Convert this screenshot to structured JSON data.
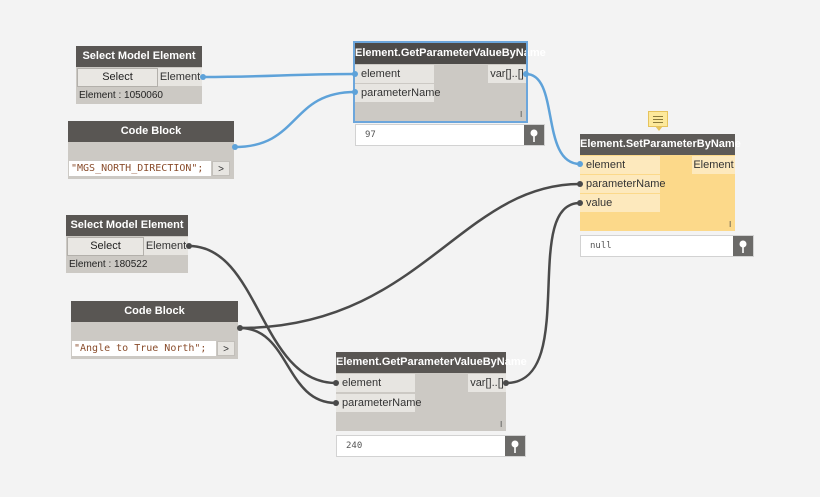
{
  "nodes": {
    "select1": {
      "title": "Select Model Element",
      "button_label": "Select",
      "output": "Element",
      "status": "Element : 1050060"
    },
    "code1": {
      "title": "Code Block",
      "code": "\"MGS_NORTH_DIRECTION\";",
      "arrow": ">"
    },
    "getparam1": {
      "title": "Element.GetParameterValueByName",
      "inputs": [
        "element",
        "parameterName"
      ],
      "output": "var[]..[]",
      "lacing": "l",
      "preview": "97"
    },
    "select2": {
      "title": "Select Model Element",
      "button_label": "Select",
      "output": "Element",
      "status": "Element : 180522"
    },
    "code2": {
      "title": "Code Block",
      "code": "\"Angle to True North\";",
      "arrow": ">"
    },
    "getparam2": {
      "title": "Element.GetParameterValueByName",
      "inputs": [
        "element",
        "parameterName"
      ],
      "output": "var[]..[]",
      "lacing": "l",
      "preview": "240"
    },
    "setparam": {
      "title": "Element.SetParameterByName",
      "inputs": [
        "element",
        "parameterName",
        "value"
      ],
      "output": "Element",
      "lacing": "l",
      "preview": "null"
    }
  },
  "icons": {
    "pin": "pin-icon",
    "tooltip": "tooltip-note-icon"
  },
  "colors": {
    "selected_wire": "#5ea2d9",
    "wire": "#4a4a4a",
    "header": "#595653",
    "node_body": "#ccc9c4",
    "active_node": "#fcd98a"
  }
}
